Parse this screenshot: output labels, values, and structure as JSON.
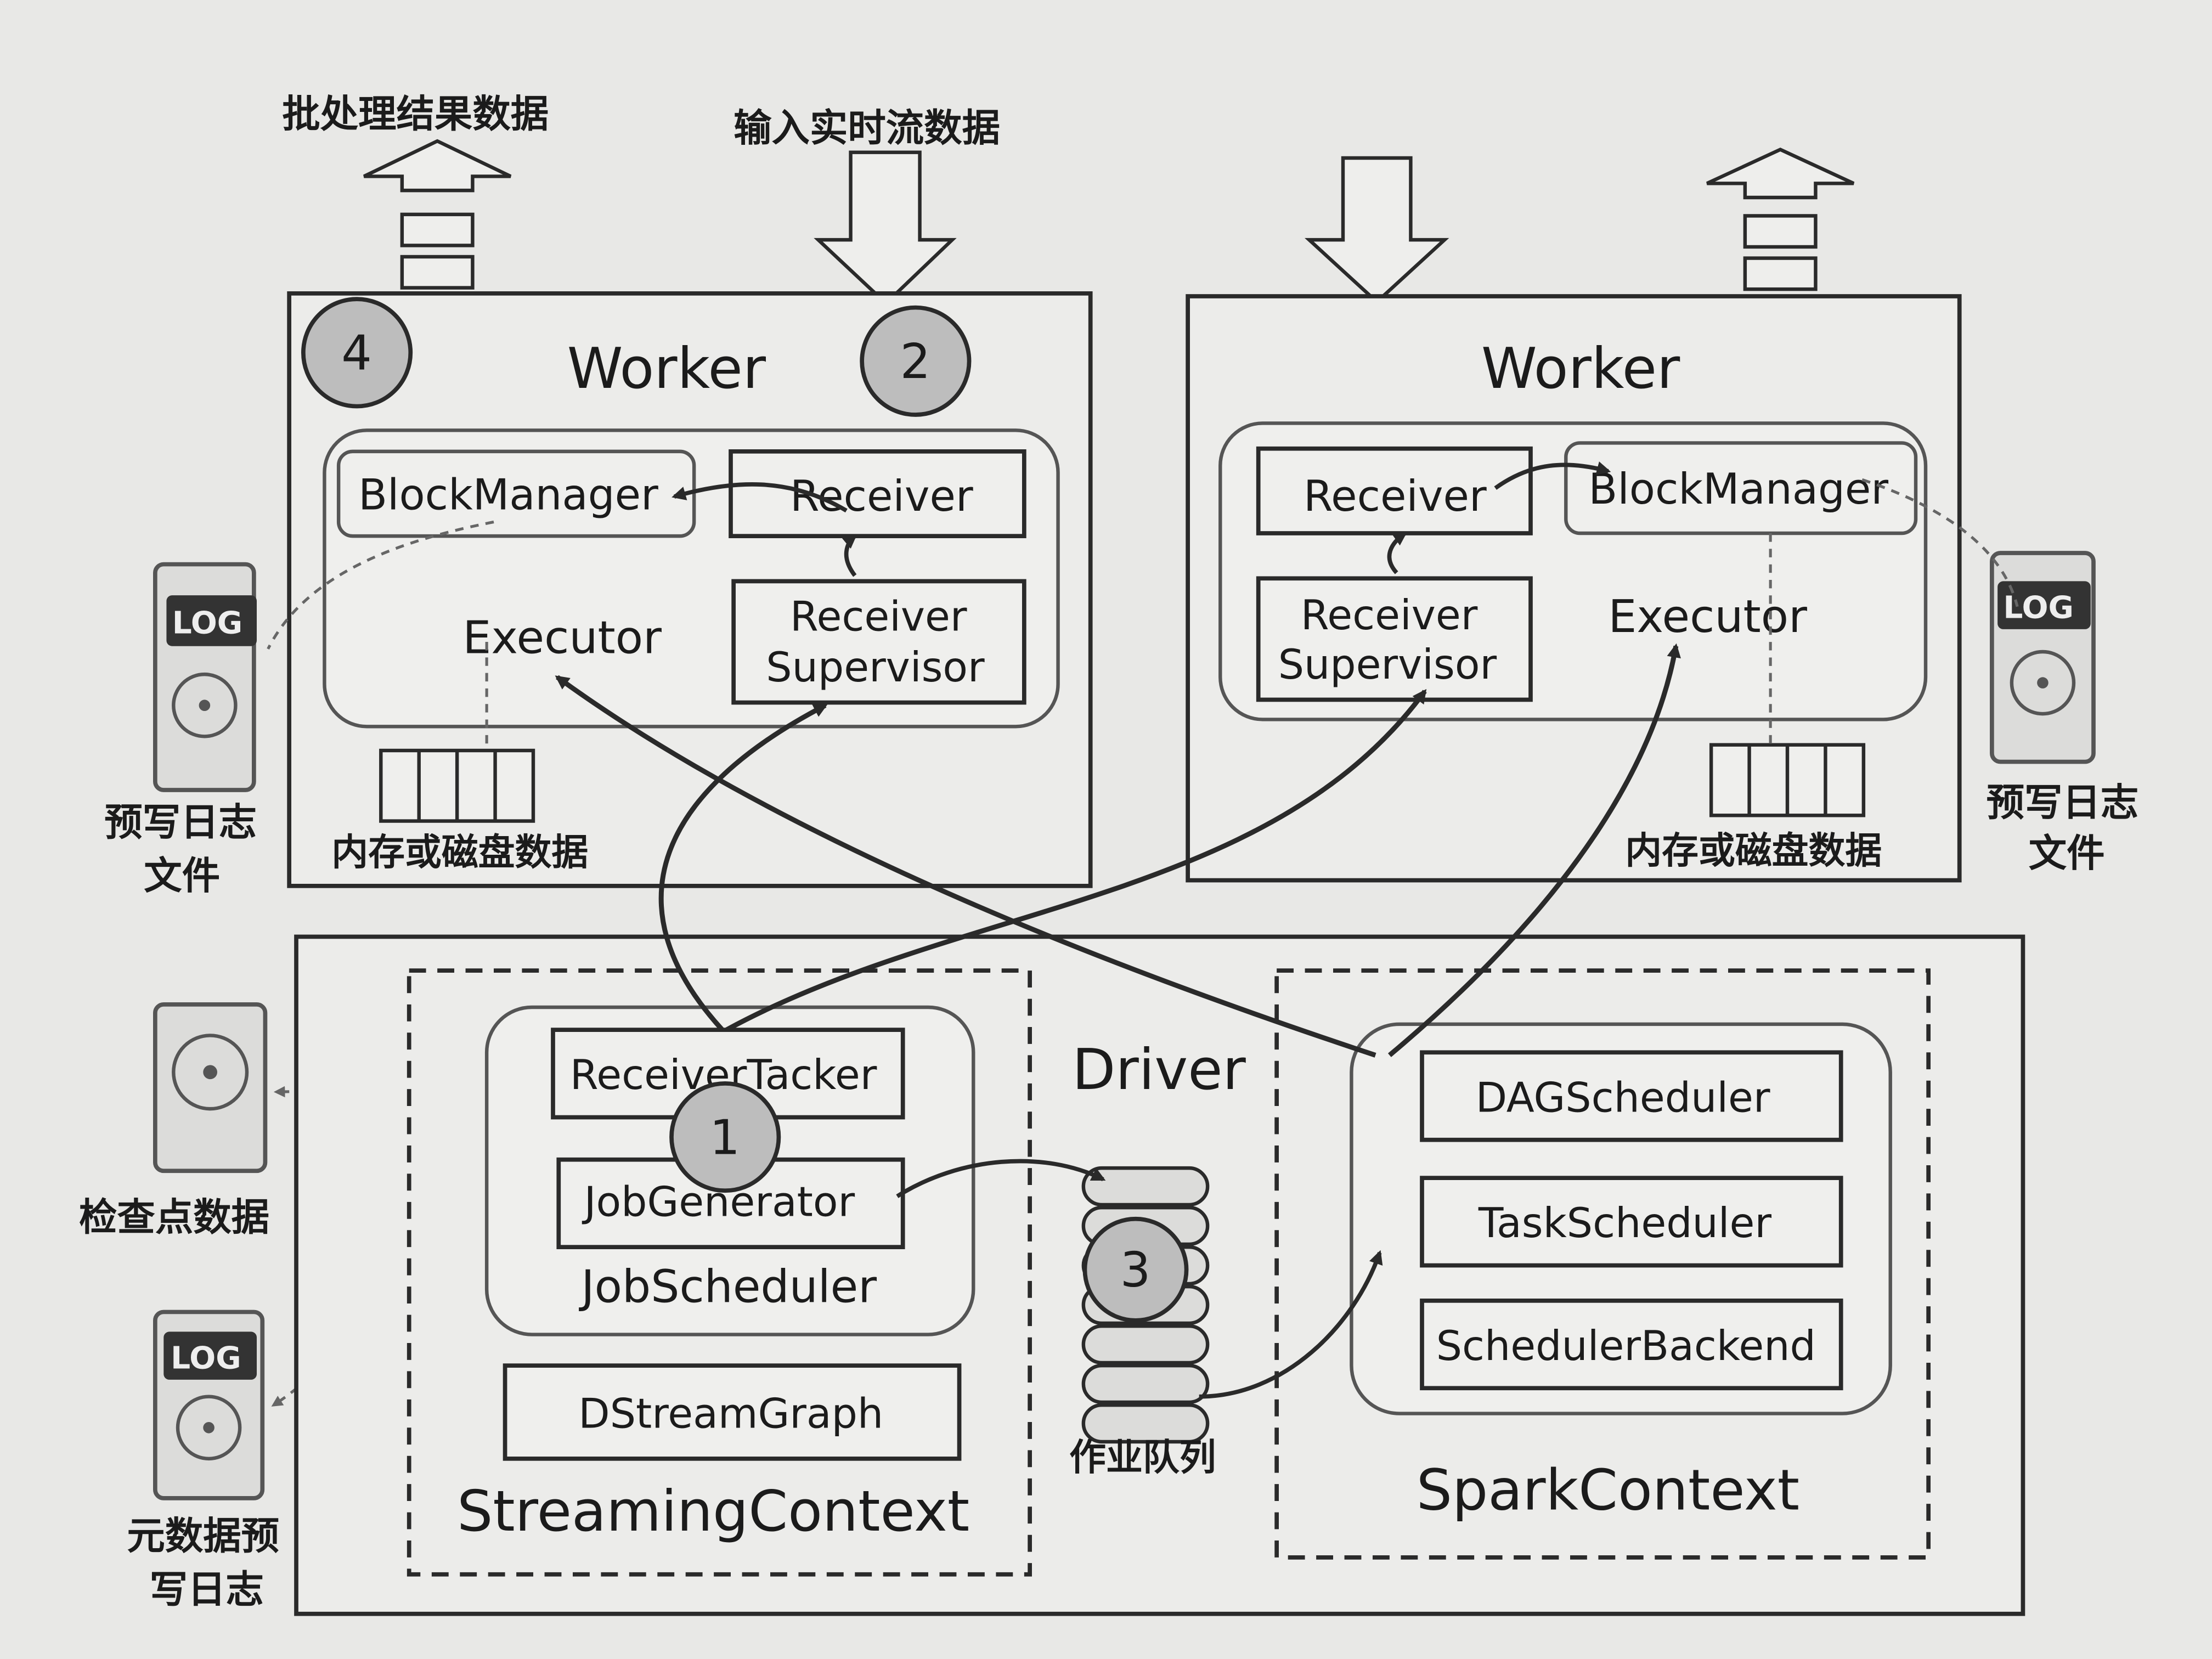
{
  "colors": {
    "background": "#e8e8e6",
    "line": "#2a2a2a",
    "panel": "#eeeeec",
    "circle_fill": "#bdbdbd",
    "text": "#1b1b1b"
  },
  "top_labels": {
    "batch_results": "批处理结果数据",
    "input_stream": "输入实时流数据"
  },
  "worker_left": {
    "title": "Worker",
    "block_manager": "BlockManager",
    "receiver": "Receiver",
    "executor": "Executor",
    "receiver_supervisor_line1": "Receiver",
    "receiver_supervisor_line2": "Supervisor",
    "storage_label": "内存或磁盘数据",
    "step_badge": "4",
    "step_badge_2": "2"
  },
  "worker_right": {
    "title": "Worker",
    "receiver": "Receiver",
    "block_manager": "BlockManager",
    "receiver_supervisor_line1": "Receiver",
    "receiver_supervisor_line2": "Supervisor",
    "executor": "Executor",
    "storage_label": "内存或磁盘数据"
  },
  "driver": {
    "title": "Driver",
    "receiver_tracker": "ReceiverTacker",
    "job_generator": "JobGenerator",
    "job_scheduler": "JobScheduler",
    "dstream_graph": "DStreamGraph",
    "streaming_context": "StreamingContext",
    "job_queue_label": "作业队列",
    "dag_scheduler": "DAGScheduler",
    "task_scheduler": "TaskScheduler",
    "scheduler_backend": "SchedulerBackend",
    "spark_context": "SparkContext",
    "step_badge_1": "1",
    "step_badge_3": "3"
  },
  "side_labels": {
    "wal_left_line1": "预写日志",
    "wal_left_line2": "文件",
    "wal_right_line1": "预写日志",
    "wal_right_line2": "文件",
    "checkpoint": "检查点数据",
    "metadata_wal_line1": "元数据预",
    "metadata_wal_line2": "写日志",
    "log_badge": "LOG"
  }
}
